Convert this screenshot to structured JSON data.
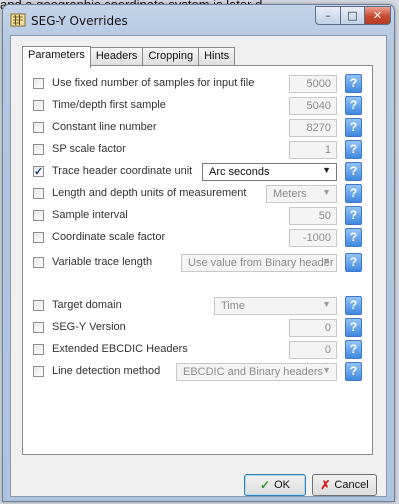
{
  "background_text": "and a geographic coordinate system is later d",
  "window": {
    "title": "SEG-Y Overrides",
    "minimize_glyph": "–",
    "maximize_glyph": "□",
    "close_glyph": "✕",
    "icon": "segy-app-icon"
  },
  "tabs": [
    "Parameters",
    "Headers",
    "Cropping",
    "Hints"
  ],
  "active_tab": "Parameters",
  "rows": [
    {
      "label": "Use fixed number of samples for input file",
      "checked": false,
      "value": "5000"
    },
    {
      "label": "Time/depth first sample",
      "checked": false,
      "value": "5040"
    },
    {
      "label": "Constant line number",
      "checked": false,
      "value": "8270"
    },
    {
      "label": "SP scale factor",
      "checked": false,
      "value": "1"
    },
    {
      "label": "Trace header coordinate unit",
      "checked": true,
      "dropdown": "Arc seconds"
    },
    {
      "label": "Length and depth units of measurement",
      "checked": false,
      "dropdown": "Meters"
    },
    {
      "label": "Sample interval",
      "checked": false,
      "value": "50"
    },
    {
      "label": "Coordinate scale factor",
      "checked": false,
      "value": "-1000"
    },
    {
      "label": "Variable trace length",
      "checked": false,
      "dropdown": "Use value from Binary header"
    },
    {
      "label": "Target domain",
      "checked": false,
      "dropdown": "Time"
    },
    {
      "label": "SEG-Y Version",
      "checked": false,
      "value": "0"
    },
    {
      "label": "Extended EBCDIC Headers",
      "checked": false,
      "value": "0"
    },
    {
      "label": "Line detection method",
      "checked": false,
      "dropdown": "EBCDIC and Binary headers"
    }
  ],
  "help_glyph": "?",
  "check_glyph": "✓",
  "dropdown_arrow": "▼",
  "buttons": {
    "ok": "OK",
    "ok_icon": "✓",
    "cancel": "Cancel",
    "cancel_icon": "✗"
  },
  "colors": {
    "help_button": "#3f88e0",
    "ok_icon": "#2f9a2f",
    "cancel_icon": "#d12020"
  }
}
